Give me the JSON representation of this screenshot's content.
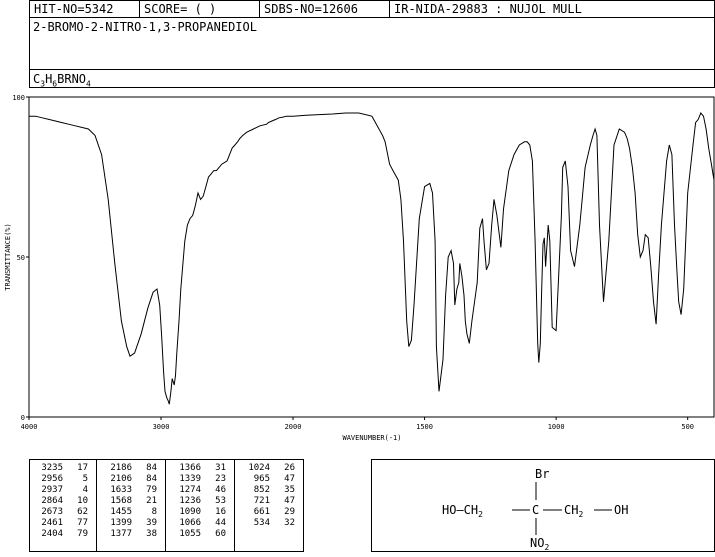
{
  "header": {
    "hit_no": "HIT-NO=5342",
    "score": "SCORE=  (   )",
    "sdbs_no": "SDBS-NO=12606",
    "ir_nida": "IR-NIDA-29883 : NUJOL MULL"
  },
  "compound_name": "2-BROMO-2-NITRO-1,3-PROPANEDIOL",
  "formula": {
    "parts": [
      "C",
      "3",
      "H",
      "6",
      "BRNO",
      "4"
    ]
  },
  "chart_data": {
    "type": "line",
    "xlabel": "WAVENUMBER(-1)",
    "ylabel": "TRANSMITTANCE(%)",
    "xlim": [
      4000,
      400
    ],
    "ylim": [
      0,
      100
    ],
    "xticks": [
      "4000",
      "3000",
      "2000",
      "1500",
      "1000",
      "500"
    ],
    "xtick_values": [
      4000,
      3000,
      2000,
      1500,
      1000,
      500
    ],
    "yticks": [
      "100",
      "50",
      "0"
    ],
    "ytick_values": [
      100,
      50,
      0
    ],
    "grid": false,
    "series": [
      {
        "x": [
          4000,
          3950,
          3900,
          3850,
          3800,
          3750,
          3700,
          3650,
          3600,
          3550,
          3500,
          3450,
          3400,
          3350,
          3300,
          3260,
          3235,
          3200,
          3150,
          3100,
          3060,
          3030,
          3010,
          2995,
          2980,
          2970,
          2956,
          2945,
          2937,
          2925,
          2915,
          2900,
          2890,
          2880,
          2864,
          2850,
          2820,
          2800,
          2780,
          2760,
          2740,
          2720,
          2700,
          2680,
          2660,
          2640,
          2620,
          2600,
          2580,
          2560,
          2540,
          2520,
          2500,
          2480,
          2461,
          2440,
          2420,
          2404,
          2380,
          2350,
          2300,
          2250,
          2200,
          2186,
          2160,
          2130,
          2106,
          2080,
          2050,
          2000,
          1950,
          1900,
          1850,
          1800,
          1750,
          1700,
          1680,
          1660,
          1650,
          1633,
          1620,
          1600,
          1590,
          1580,
          1568,
          1560,
          1550,
          1540,
          1520,
          1500,
          1480,
          1470,
          1460,
          1455,
          1445,
          1430,
          1420,
          1410,
          1399,
          1390,
          1385,
          1377,
          1370,
          1366,
          1358,
          1350,
          1345,
          1339,
          1330,
          1320,
          1300,
          1290,
          1280,
          1274,
          1265,
          1255,
          1245,
          1236,
          1225,
          1210,
          1200,
          1180,
          1160,
          1140,
          1120,
          1110,
          1100,
          1090,
          1080,
          1070,
          1066,
          1060,
          1055,
          1050,
          1045,
          1040,
          1030,
          1024,
          1015,
          1000,
          990,
          980,
          975,
          965,
          955,
          945,
          930,
          910,
          890,
          870,
          860,
          852,
          845,
          835,
          820,
          800,
          780,
          760,
          740,
          730,
          721,
          710,
          700,
          690,
          680,
          670,
          661,
          650,
          640,
          630,
          620,
          610,
          600,
          590,
          580,
          570,
          560,
          550,
          540,
          534,
          525,
          515,
          500,
          480,
          470,
          460,
          450,
          440,
          430,
          420,
          410,
          400
        ],
        "y": [
          94,
          94,
          93.5,
          93,
          92.5,
          92,
          91.5,
          91,
          90.5,
          90,
          88,
          82,
          68,
          48,
          30,
          22,
          19,
          20,
          26,
          34,
          39,
          40,
          35,
          25,
          14,
          8,
          6,
          5,
          4,
          8,
          12,
          10,
          13,
          20,
          30,
          40,
          55,
          60,
          62,
          63,
          66,
          70,
          68,
          69,
          72,
          75,
          76,
          77,
          77,
          78,
          79,
          79.5,
          80,
          82,
          84,
          85,
          86,
          87,
          88,
          89,
          90,
          91,
          91.5,
          92,
          92.5,
          93,
          93.5,
          93.7,
          94,
          94,
          94.3,
          94.5,
          94.7,
          95,
          95,
          94,
          91,
          88,
          86,
          79,
          77,
          74,
          68,
          55,
          30,
          22,
          24,
          35,
          62,
          72,
          73,
          70,
          55,
          22,
          8,
          18,
          38,
          50,
          52,
          48,
          35,
          40,
          42,
          48,
          44,
          38,
          30,
          26,
          23,
          30,
          42,
          59,
          62,
          55,
          46,
          48,
          60,
          68,
          63,
          53,
          65,
          77,
          82,
          85,
          86,
          86,
          85,
          80,
          55,
          23,
          17,
          23,
          40,
          54,
          56,
          47,
          60,
          55,
          28,
          27,
          45,
          63,
          78,
          80,
          72,
          52,
          47,
          60,
          78,
          85,
          88,
          90,
          88,
          60,
          36,
          55,
          85,
          90,
          89,
          87,
          84,
          78,
          70,
          57,
          50,
          52,
          57,
          56,
          47,
          36,
          29,
          45,
          60,
          70,
          80,
          85,
          82,
          60,
          44,
          36,
          32,
          40,
          70,
          85,
          92,
          93,
          95,
          94,
          90,
          84,
          79,
          74
        ]
      }
    ],
    "peak_table": [
      [
        "3235",
        "17"
      ],
      [
        "2956",
        "5"
      ],
      [
        "2937",
        "4"
      ],
      [
        "2864",
        "10"
      ],
      [
        "2673",
        "62"
      ],
      [
        "2461",
        "77"
      ],
      [
        "2404",
        "79"
      ],
      [
        "2186",
        "84"
      ],
      [
        "2106",
        "84"
      ],
      [
        "1633",
        "79"
      ],
      [
        "1568",
        "21"
      ],
      [
        "1455",
        "8"
      ],
      [
        "1399",
        "39"
      ],
      [
        "1377",
        "38"
      ],
      [
        "1366",
        "31"
      ],
      [
        "1339",
        "23"
      ],
      [
        "1274",
        "46"
      ],
      [
        "1236",
        "53"
      ],
      [
        "1090",
        "16"
      ],
      [
        "1066",
        "44"
      ],
      [
        "1055",
        "60"
      ],
      [
        "1024",
        "26"
      ],
      [
        "965",
        "47"
      ],
      [
        "852",
        "35"
      ],
      [
        "721",
        "47"
      ],
      [
        "661",
        "29"
      ],
      [
        "534",
        "32"
      ]
    ]
  },
  "structure": {
    "top_label": "Br",
    "left_label": "HO—CH",
    "left_sub": "2",
    "center_label": "C",
    "right_label": "CH",
    "right_sub": "2",
    "right_end": "OH",
    "bottom_label": "NO",
    "bottom_sub": "2"
  }
}
